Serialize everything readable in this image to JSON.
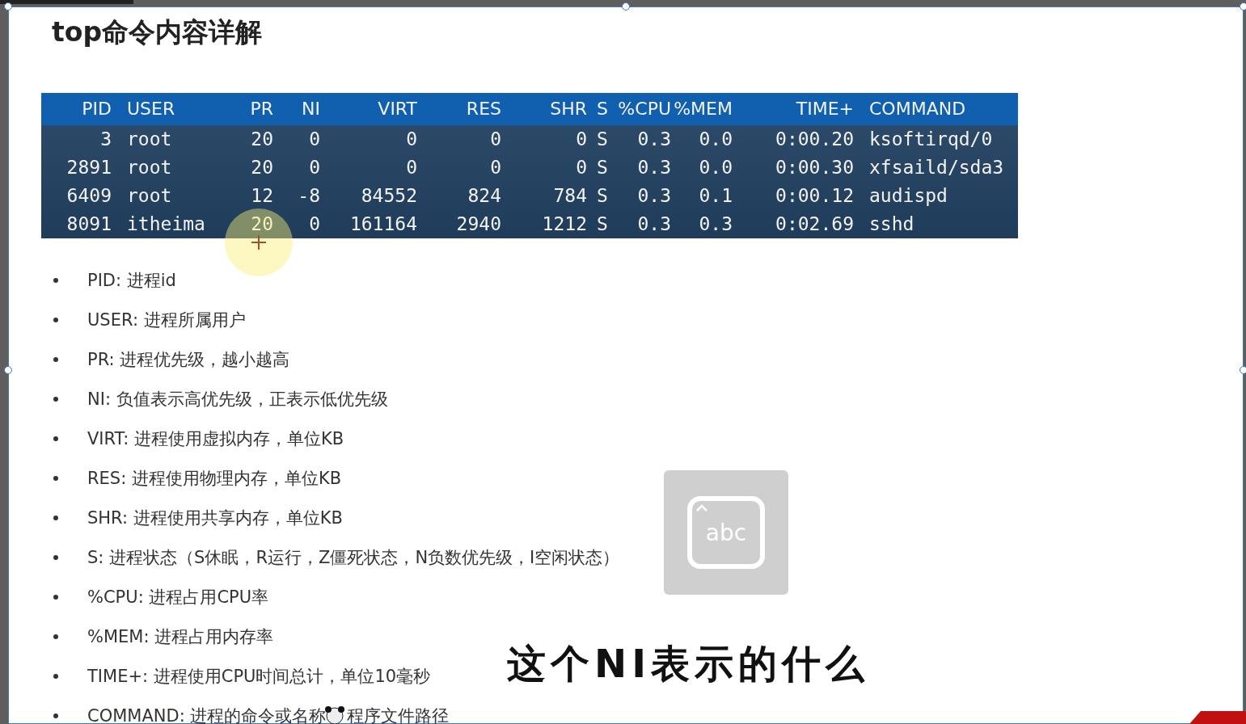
{
  "title": "top命令内容详解",
  "table": {
    "columns": [
      "PID",
      "USER",
      "PR",
      "NI",
      "VIRT",
      "RES",
      "SHR",
      "S",
      "%CPU",
      "%MEM",
      "TIME+",
      "COMMAND"
    ],
    "rows": [
      [
        "3",
        "root",
        "20",
        "0",
        "0",
        "0",
        "0",
        "S",
        "0.3",
        "0.0",
        "0:00.20",
        "ksoftirqd/0"
      ],
      [
        "2891",
        "root",
        "20",
        "0",
        "0",
        "0",
        "0",
        "S",
        "0.3",
        "0.0",
        "0:00.30",
        "xfsaild/sda3"
      ],
      [
        "6409",
        "root",
        "12",
        "-8",
        "84552",
        "824",
        "784",
        "S",
        "0.3",
        "0.1",
        "0:00.12",
        "audispd"
      ],
      [
        "8091",
        "itheima",
        "20",
        "0",
        "161164",
        "2940",
        "1212",
        "S",
        "0.3",
        "0.3",
        "0:02.69",
        "sshd"
      ]
    ]
  },
  "bullets": [
    "PID: 进程id",
    "USER: 进程所属用户",
    "PR: 进程优先级，越小越高",
    "NI: 负值表示高优先级，正表示低优先级",
    "VIRT: 进程使用虚拟内存，单位KB",
    "RES: 进程使用物理内存，单位KB",
    "SHR: 进程使用共享内存，单位KB",
    "S: 进程状态（S休眠，R运行，Z僵死状态，N负数优先级，I空闲状态）",
    "%CPU: 进程占用CPU率",
    "%MEM: 进程占用内存率",
    "TIME+: 进程使用CPU时间总计，单位10毫秒"
  ],
  "covered_bullet": {
    "before": "COMMAND: 进程的命令或名称",
    "after": "程序文件路径"
  },
  "input_indicator": {
    "label": "abc"
  },
  "subtitle": "这个NI表示的什么"
}
